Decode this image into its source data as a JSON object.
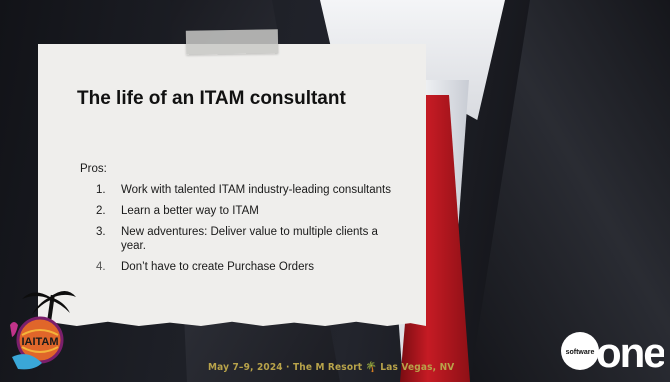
{
  "slide": {
    "title": "The life of an ITAM consultant",
    "pros_label": "Pros:",
    "items": [
      {
        "num": "1.",
        "text": "Work with talented ITAM industry-leading consultants"
      },
      {
        "num": "2.",
        "text": "Learn a better way to ITAM"
      },
      {
        "num": "3.",
        "text": "New adventures: Deliver value to multiple clients a year."
      },
      {
        "num": "4.",
        "text": "Don’t have to create Purchase Orders"
      }
    ]
  },
  "logos": {
    "event_logo_text": "IAITAM",
    "brand_small": "software",
    "brand_large": "one"
  },
  "footer": {
    "text": "May 7–9, 2024 · The M Resort 🌴 Las Vegas, NV"
  },
  "colors": {
    "accent_tie": "#c51b24",
    "card": "#efeeec",
    "footer": "#b8a34a"
  }
}
